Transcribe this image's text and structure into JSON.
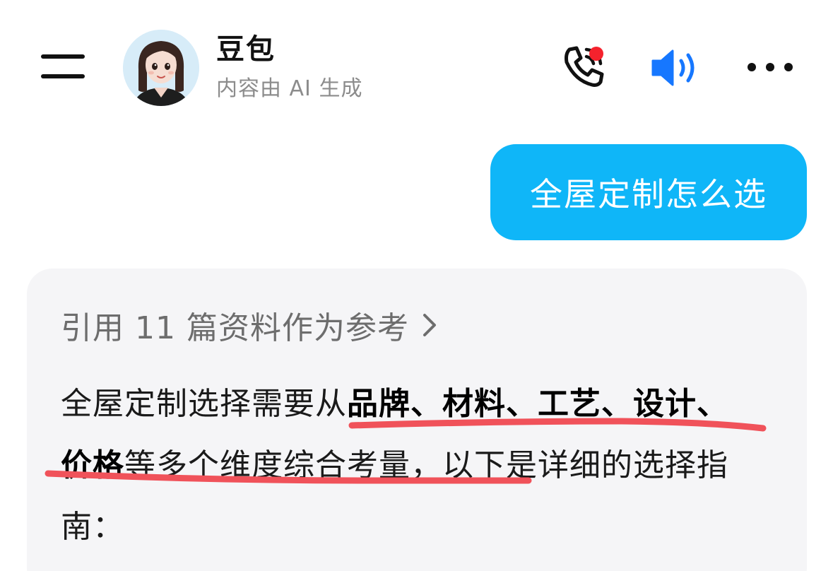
{
  "header": {
    "bot_name": "豆包",
    "bot_subtitle": "内容由 AI 生成",
    "icons": {
      "menu": "menu-icon",
      "phone": "phone-call-icon",
      "speaker": "speaker-icon",
      "more": "more-horizontal-icon"
    },
    "notification_dot_color": "#f5222d"
  },
  "user_message": {
    "text": "全屋定制怎么选",
    "bubble_color": "#0fb6f8"
  },
  "bot_message": {
    "reference_text": "引用 11 篇资料作为参考",
    "answer": {
      "seg1": "全屋定制选择需要从",
      "seg2_bold": "品牌、材料、工艺、设计、价格",
      "seg3": "等多个维度综合考量，以下是详细的选择指南："
    }
  },
  "annotation": {
    "underline_color": "#f0525a"
  }
}
